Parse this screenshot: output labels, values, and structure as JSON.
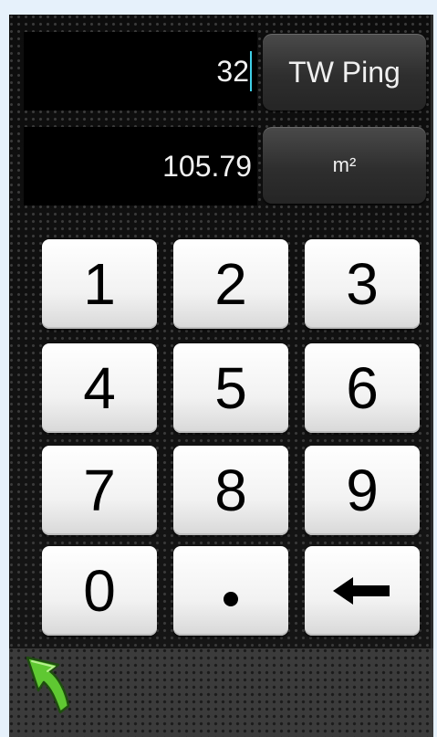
{
  "converter": {
    "input_value": "32",
    "input_unit": "TW Ping",
    "output_value": "105.79",
    "output_unit": "m²"
  },
  "keypad": {
    "keys": [
      "1",
      "2",
      "3",
      "4",
      "5",
      "6",
      "7",
      "8",
      "9",
      "0",
      "•",
      "←"
    ]
  },
  "colors": {
    "cursor": "#3fd0e8",
    "back_arrow": "#5fc832",
    "background": "#e6f1fb"
  },
  "icons": {
    "back": "back-arrow-icon",
    "backspace": "backspace-arrow-icon",
    "decimal": "decimal-point-icon"
  }
}
